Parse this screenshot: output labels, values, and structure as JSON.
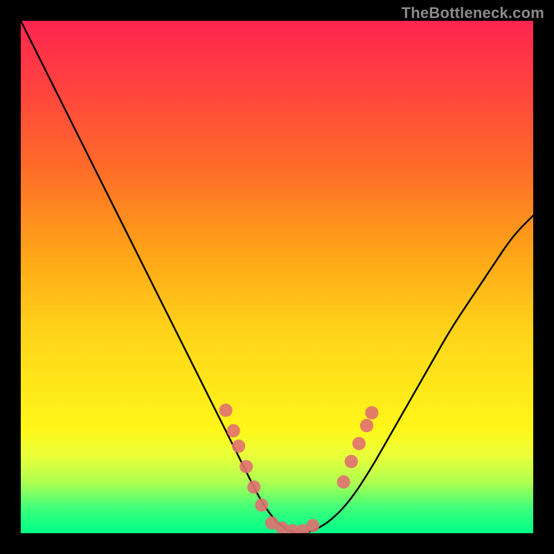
{
  "watermark": {
    "text": "TheBottleneck.com"
  },
  "chart_data": {
    "type": "line",
    "title": "",
    "xlabel": "",
    "ylabel": "",
    "xlim": [
      0,
      100
    ],
    "ylim": [
      0,
      100
    ],
    "series": [
      {
        "name": "curve",
        "x": [
          0,
          2,
          5,
          8,
          12,
          16,
          20,
          24,
          28,
          32,
          36,
          40,
          44,
          47,
          50,
          53,
          56,
          60,
          64,
          68,
          72,
          76,
          80,
          84,
          88,
          92,
          96,
          100
        ],
        "y": [
          100,
          96,
          90,
          84,
          76,
          68,
          60,
          52,
          44,
          36,
          28,
          20,
          12,
          6,
          2,
          0,
          0,
          2,
          6,
          12,
          19,
          26,
          33,
          40,
          46,
          52,
          58,
          62
        ]
      }
    ],
    "markers": [
      {
        "name": "left-marker-1",
        "x": 40.0,
        "y": 24.0
      },
      {
        "name": "left-marker-2",
        "x": 41.5,
        "y": 20.0
      },
      {
        "name": "left-marker-3",
        "x": 42.5,
        "y": 17.0
      },
      {
        "name": "left-marker-4",
        "x": 44.0,
        "y": 13.0
      },
      {
        "name": "left-marker-5",
        "x": 45.5,
        "y": 9.0
      },
      {
        "name": "left-marker-6",
        "x": 47.0,
        "y": 5.5
      },
      {
        "name": "trough-1",
        "x": 49.0,
        "y": 2.0
      },
      {
        "name": "trough-2",
        "x": 51.0,
        "y": 1.0
      },
      {
        "name": "trough-3",
        "x": 53.0,
        "y": 0.5
      },
      {
        "name": "trough-4",
        "x": 55.0,
        "y": 0.5
      },
      {
        "name": "trough-5",
        "x": 57.0,
        "y": 1.5
      },
      {
        "name": "right-marker-1",
        "x": 63.0,
        "y": 10.0
      },
      {
        "name": "right-marker-2",
        "x": 64.5,
        "y": 14.0
      },
      {
        "name": "right-marker-3",
        "x": 66.0,
        "y": 17.5
      },
      {
        "name": "right-marker-4",
        "x": 67.5,
        "y": 21.0
      },
      {
        "name": "right-marker-5",
        "x": 68.5,
        "y": 23.5
      }
    ],
    "marker_style": {
      "color": "#e07070",
      "radius_percent": 1.3
    }
  }
}
